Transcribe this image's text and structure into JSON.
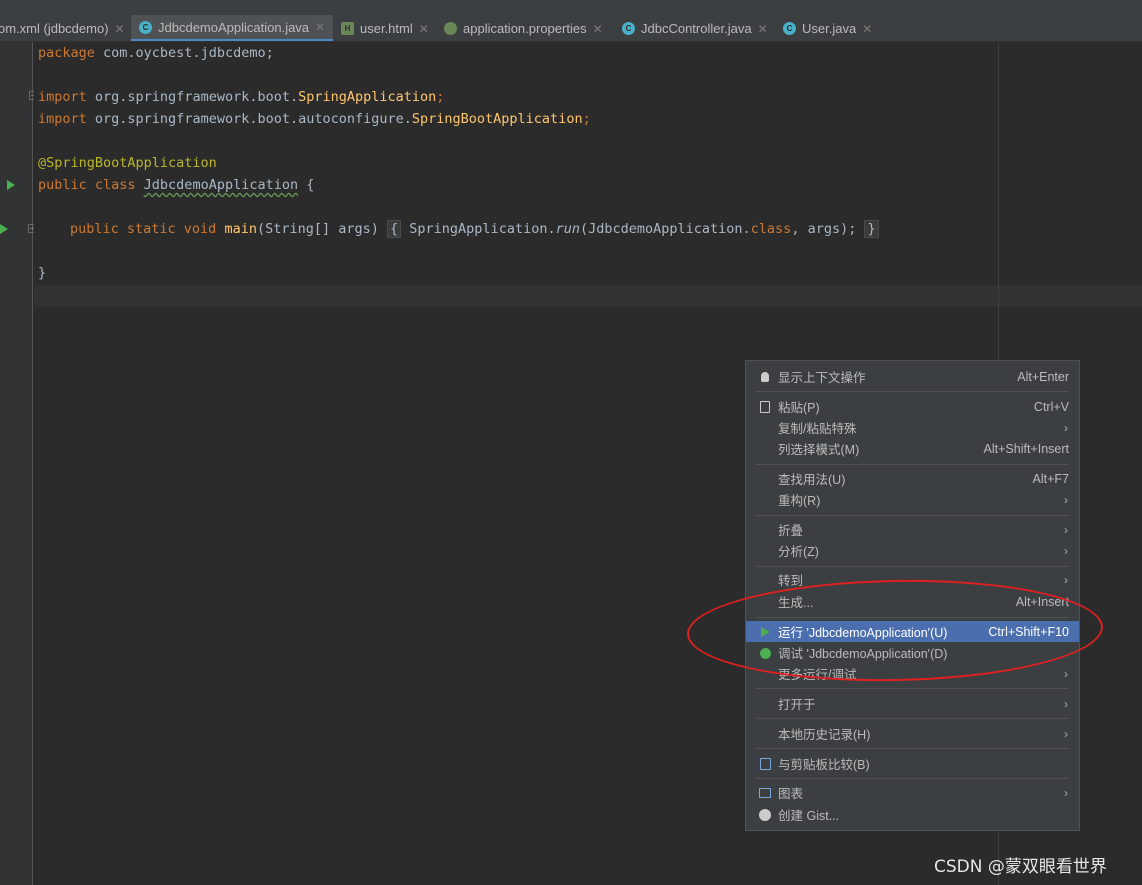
{
  "tabs": [
    {
      "label": "om.xml (jdbcdemo)",
      "icon": "maven-icon",
      "color": "#bbbbbb"
    },
    {
      "label": "JdbcdemoApplication.java",
      "icon": "spring-class-icon",
      "color": "#4ab0c8",
      "active": true
    },
    {
      "label": "user.html",
      "icon": "html-file-icon",
      "color": "#6a8759"
    },
    {
      "label": "application.properties",
      "icon": "spring-leaf-icon",
      "color": "#6a8759"
    },
    {
      "label": "JdbcController.java",
      "icon": "class-icon",
      "color": "#4ab0c8"
    },
    {
      "label": "User.java",
      "icon": "class-icon",
      "color": "#4ab0c8"
    }
  ],
  "code": {
    "l1_kw": "package",
    "l1_rest": " com.oycbest.jdbcdemo;",
    "l3_kw": "import",
    "l3_pkg": " org.springframework.boot.",
    "l3_cls": "SpringApplication",
    "l3_semi": ";",
    "l4_kw": "import",
    "l4_pkg": " org.springframework.boot.autoconfigure.",
    "l4_cls": "SpringBootApplication",
    "l4_semi": ";",
    "l6_ann": "@SpringBootApplication",
    "l7_kw": "public class ",
    "l7_name": "JdbcdemoApplication",
    "l7_rest": " {",
    "l9_kw": "public static void ",
    "l9_fn": "main",
    "l9_params": "(String[] args)",
    "l9_open": "{",
    "l9_body1": " SpringApplication.",
    "l9_run": "run",
    "l9_body2": "(JdbcdemoApplication.",
    "l9_class_kw": "class",
    "l9_body3": ", args);",
    "l9_close": "}",
    "l11": "}"
  },
  "menu": {
    "items": [
      {
        "label": "显示上下文操作",
        "shortcut": "Alt+Enter",
        "icon": "lightbulb-icon"
      },
      {
        "label": "粘贴(P)",
        "shortcut": "Ctrl+V",
        "icon": "clipboard-icon"
      },
      {
        "label": "复制/粘贴特殊",
        "submenu": true
      },
      {
        "label": "列选择模式(M)",
        "shortcut": "Alt+Shift+Insert"
      },
      {
        "label": "查找用法(U)",
        "shortcut": "Alt+F7"
      },
      {
        "label": "重构(R)",
        "submenu": true
      },
      {
        "label": "折叠",
        "submenu": true
      },
      {
        "label": "分析(Z)",
        "submenu": true
      },
      {
        "label": "转到",
        "submenu": true
      },
      {
        "label": "生成...",
        "shortcut": "Alt+Insert"
      },
      {
        "label": "运行 'JdbcdemoApplication'(U)",
        "shortcut": "Ctrl+Shift+F10",
        "icon": "run-icon",
        "selected": true
      },
      {
        "label": "调试 'JdbcdemoApplication'(D)",
        "icon": "debug-icon"
      },
      {
        "label": "更多运行/调试",
        "submenu": true
      },
      {
        "label": "打开于",
        "submenu": true
      },
      {
        "label": "本地历史记录(H)",
        "submenu": true
      },
      {
        "label": "与剪贴板比较(B)",
        "icon": "compare-clipboard-icon"
      },
      {
        "label": "图表",
        "submenu": true,
        "icon": "diagram-icon"
      },
      {
        "label": "创建 Gist...",
        "icon": "github-icon"
      }
    ],
    "submenu_arrow": "›"
  },
  "watermark": "CSDN @蒙双眼看世界",
  "colors": {
    "editor_bg": "#2b2b2b",
    "keyword": "#cc7832",
    "annotation": "#bbb529",
    "function": "#ffc66d",
    "menu_bg": "#3c3f41",
    "menu_selected": "#4b6eaf",
    "highlight_ellipse": "#e02020"
  }
}
